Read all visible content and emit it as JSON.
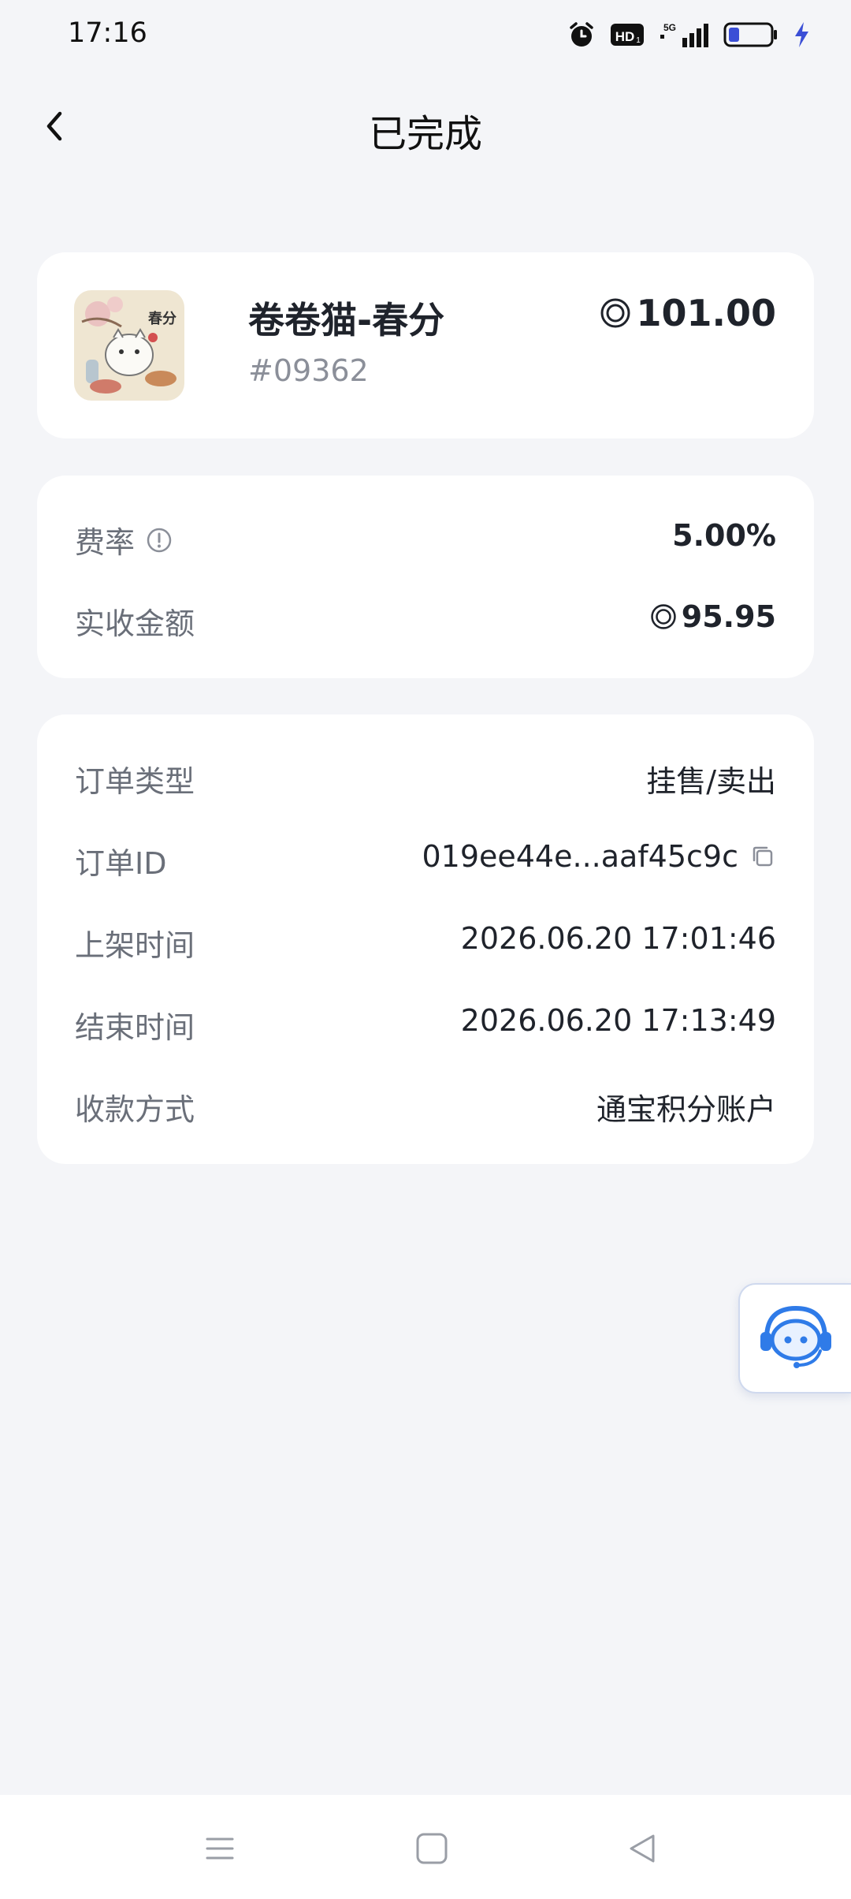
{
  "status_bar": {
    "time": "17:16"
  },
  "header": {
    "title": "已完成"
  },
  "product": {
    "name": "卷卷猫-春分",
    "serial": "#09362",
    "price": "101.00",
    "thumbnail_text": "春分"
  },
  "fees": {
    "rate_label": "费率",
    "rate_value": "5.00%",
    "received_label": "实收金额",
    "received_value": "95.95"
  },
  "order": {
    "type_label": "订单类型",
    "type_value": "挂售/卖出",
    "id_label": "订单ID",
    "id_value": "019ee44e...aaf45c9c",
    "listed_label": "上架时间",
    "listed_value": "2026.06.20 17:01:46",
    "ended_label": "结束时间",
    "ended_value": "2026.06.20 17:13:49",
    "payment_label": "收款方式",
    "payment_value": "通宝积分账户"
  },
  "colors": {
    "background": "#f4f5f8",
    "card": "#ffffff",
    "text_primary": "#1f232b",
    "text_secondary": "#6a6f79",
    "accent_blue": "#2f7be8"
  },
  "icons": [
    "alarm-icon",
    "hd-icon",
    "signal-5g-icon",
    "battery-icon",
    "charging-icon",
    "back-arrow-icon",
    "coin-icon",
    "info-icon",
    "copy-icon",
    "customer-service-icon",
    "nav-menu-icon",
    "nav-home-icon",
    "nav-back-icon"
  ]
}
